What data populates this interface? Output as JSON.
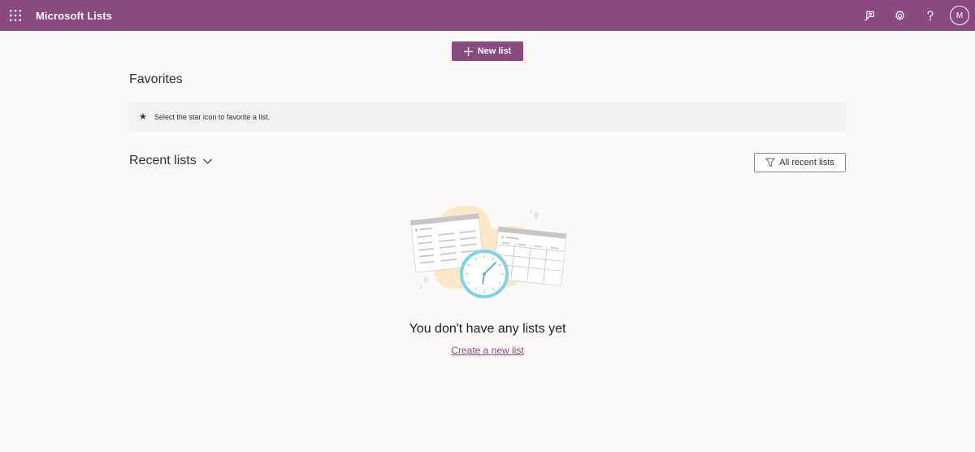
{
  "header": {
    "app_title": "Microsoft Lists",
    "avatar_initial": "M",
    "brand_color": "#8a4a7e"
  },
  "toolbar": {
    "new_list_label": "New list"
  },
  "favorites": {
    "title": "Favorites",
    "hint": "Select the star icon to favorite a list."
  },
  "recent": {
    "title": "Recent lists",
    "filter_label": "All recent lists"
  },
  "empty_state": {
    "message": "You don't have any lists yet",
    "link_label": "Create a new list"
  },
  "icons": {
    "waffle": "app-launcher-icon",
    "feedback": "feedback-icon",
    "settings": "gear-icon",
    "help": "help-icon",
    "star": "star-icon",
    "chevron": "chevron-down-icon",
    "filter": "filter-icon"
  }
}
